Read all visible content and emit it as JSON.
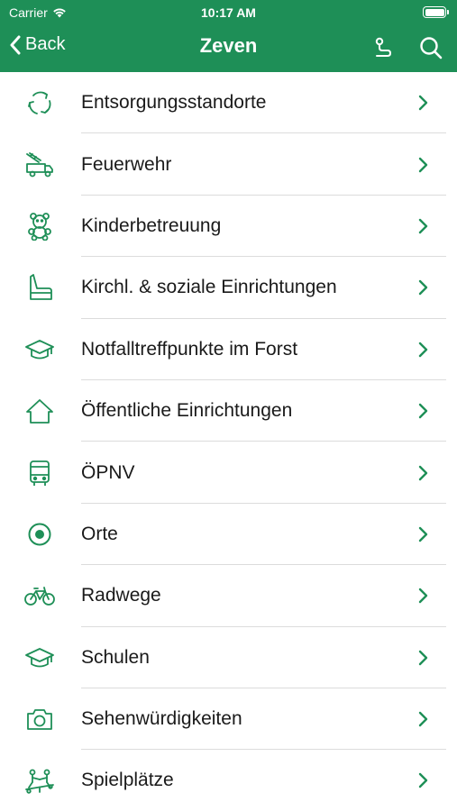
{
  "status_bar": {
    "carrier": "Carrier",
    "time": "10:17 AM"
  },
  "nav": {
    "back_label": "Back",
    "title": "Zeven"
  },
  "colors": {
    "brand": "#1e8f57",
    "accent": "#1e8f57"
  },
  "items": [
    {
      "label": "Entsorgungsstandorte",
      "icon": "recycle-icon"
    },
    {
      "label": "Feuerwehr",
      "icon": "fire-truck-icon"
    },
    {
      "label": "Kinderbetreuung",
      "icon": "teddy-bear-icon"
    },
    {
      "label": "Kirchl. & soziale Einrichtungen",
      "icon": "chair-icon"
    },
    {
      "label": "Notfalltreffpunkte im Forst",
      "icon": "graduation-cap-icon"
    },
    {
      "label": "Öffentliche Einrichtungen",
      "icon": "house-icon"
    },
    {
      "label": "ÖPNV",
      "icon": "bus-icon"
    },
    {
      "label": "Orte",
      "icon": "location-dot-icon"
    },
    {
      "label": "Radwege",
      "icon": "bicycle-icon"
    },
    {
      "label": "Schulen",
      "icon": "graduation-cap-icon"
    },
    {
      "label": "Sehenwürdigkeiten",
      "icon": "camera-icon"
    },
    {
      "label": "Spielplätze",
      "icon": "playground-icon"
    }
  ]
}
